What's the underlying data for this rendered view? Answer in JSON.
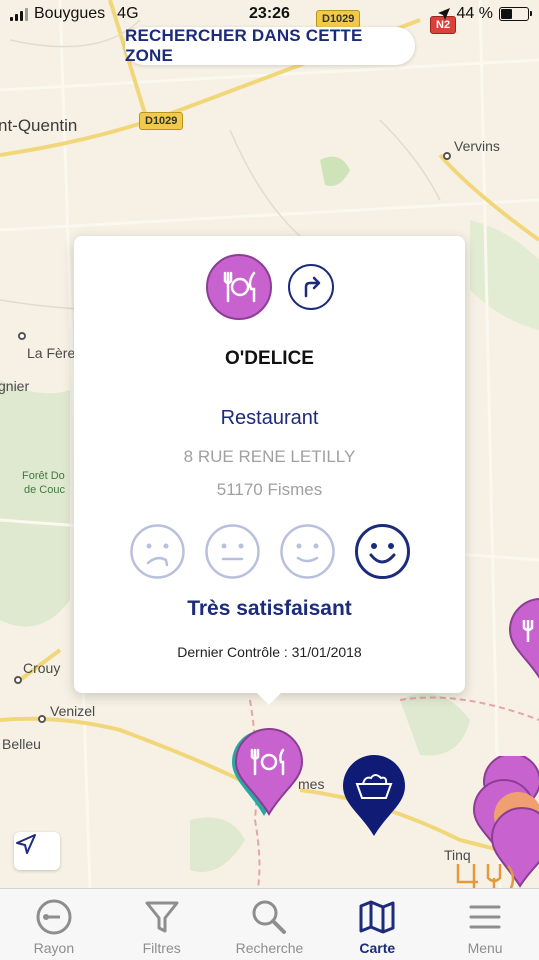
{
  "status_bar": {
    "carrier": "Bouygues",
    "network": "4G",
    "time": "23:26",
    "battery": "44 %",
    "battery_level": 0.44
  },
  "map": {
    "search_zone_label": "RECHERCHER DANS CETTE ZONE",
    "places": [
      "nt-Quentin",
      "Vervins",
      "La Fère",
      "gnier",
      "Forêt Do",
      "de Couc",
      "Crouy",
      "Venizel",
      "Belleu",
      "mes",
      "Tinq"
    ],
    "roads": [
      "D1029",
      "D1029",
      "N2"
    ]
  },
  "popup": {
    "name": "O'DELICE",
    "category": "Restaurant",
    "address": "8 RUE RENE LETILLY",
    "city": "51170  Fismes",
    "rating_label": "Très satisfaisant",
    "rating_level": 4,
    "rating_levels_total": 4,
    "last_control": "Dernier Contrôle : 31/01/2018",
    "category_icon": "restaurant-icon",
    "directions_icon": "directions-icon"
  },
  "tabs": [
    {
      "label": "Rayon",
      "icon": "radius-icon",
      "active": false
    },
    {
      "label": "Filtres",
      "icon": "filter-icon",
      "active": false
    },
    {
      "label": "Recherche",
      "icon": "search-icon",
      "active": false
    },
    {
      "label": "Carte",
      "icon": "map-icon",
      "active": true
    },
    {
      "label": "Menu",
      "icon": "menu-icon",
      "active": false
    }
  ],
  "colors": {
    "brand_navy": "#1c2b7a",
    "restaurant_purple": "#c862cf",
    "map_background": "#f6f1e4",
    "active_face": "#1c2b7a",
    "inactive_face": "#b9c0dd"
  }
}
